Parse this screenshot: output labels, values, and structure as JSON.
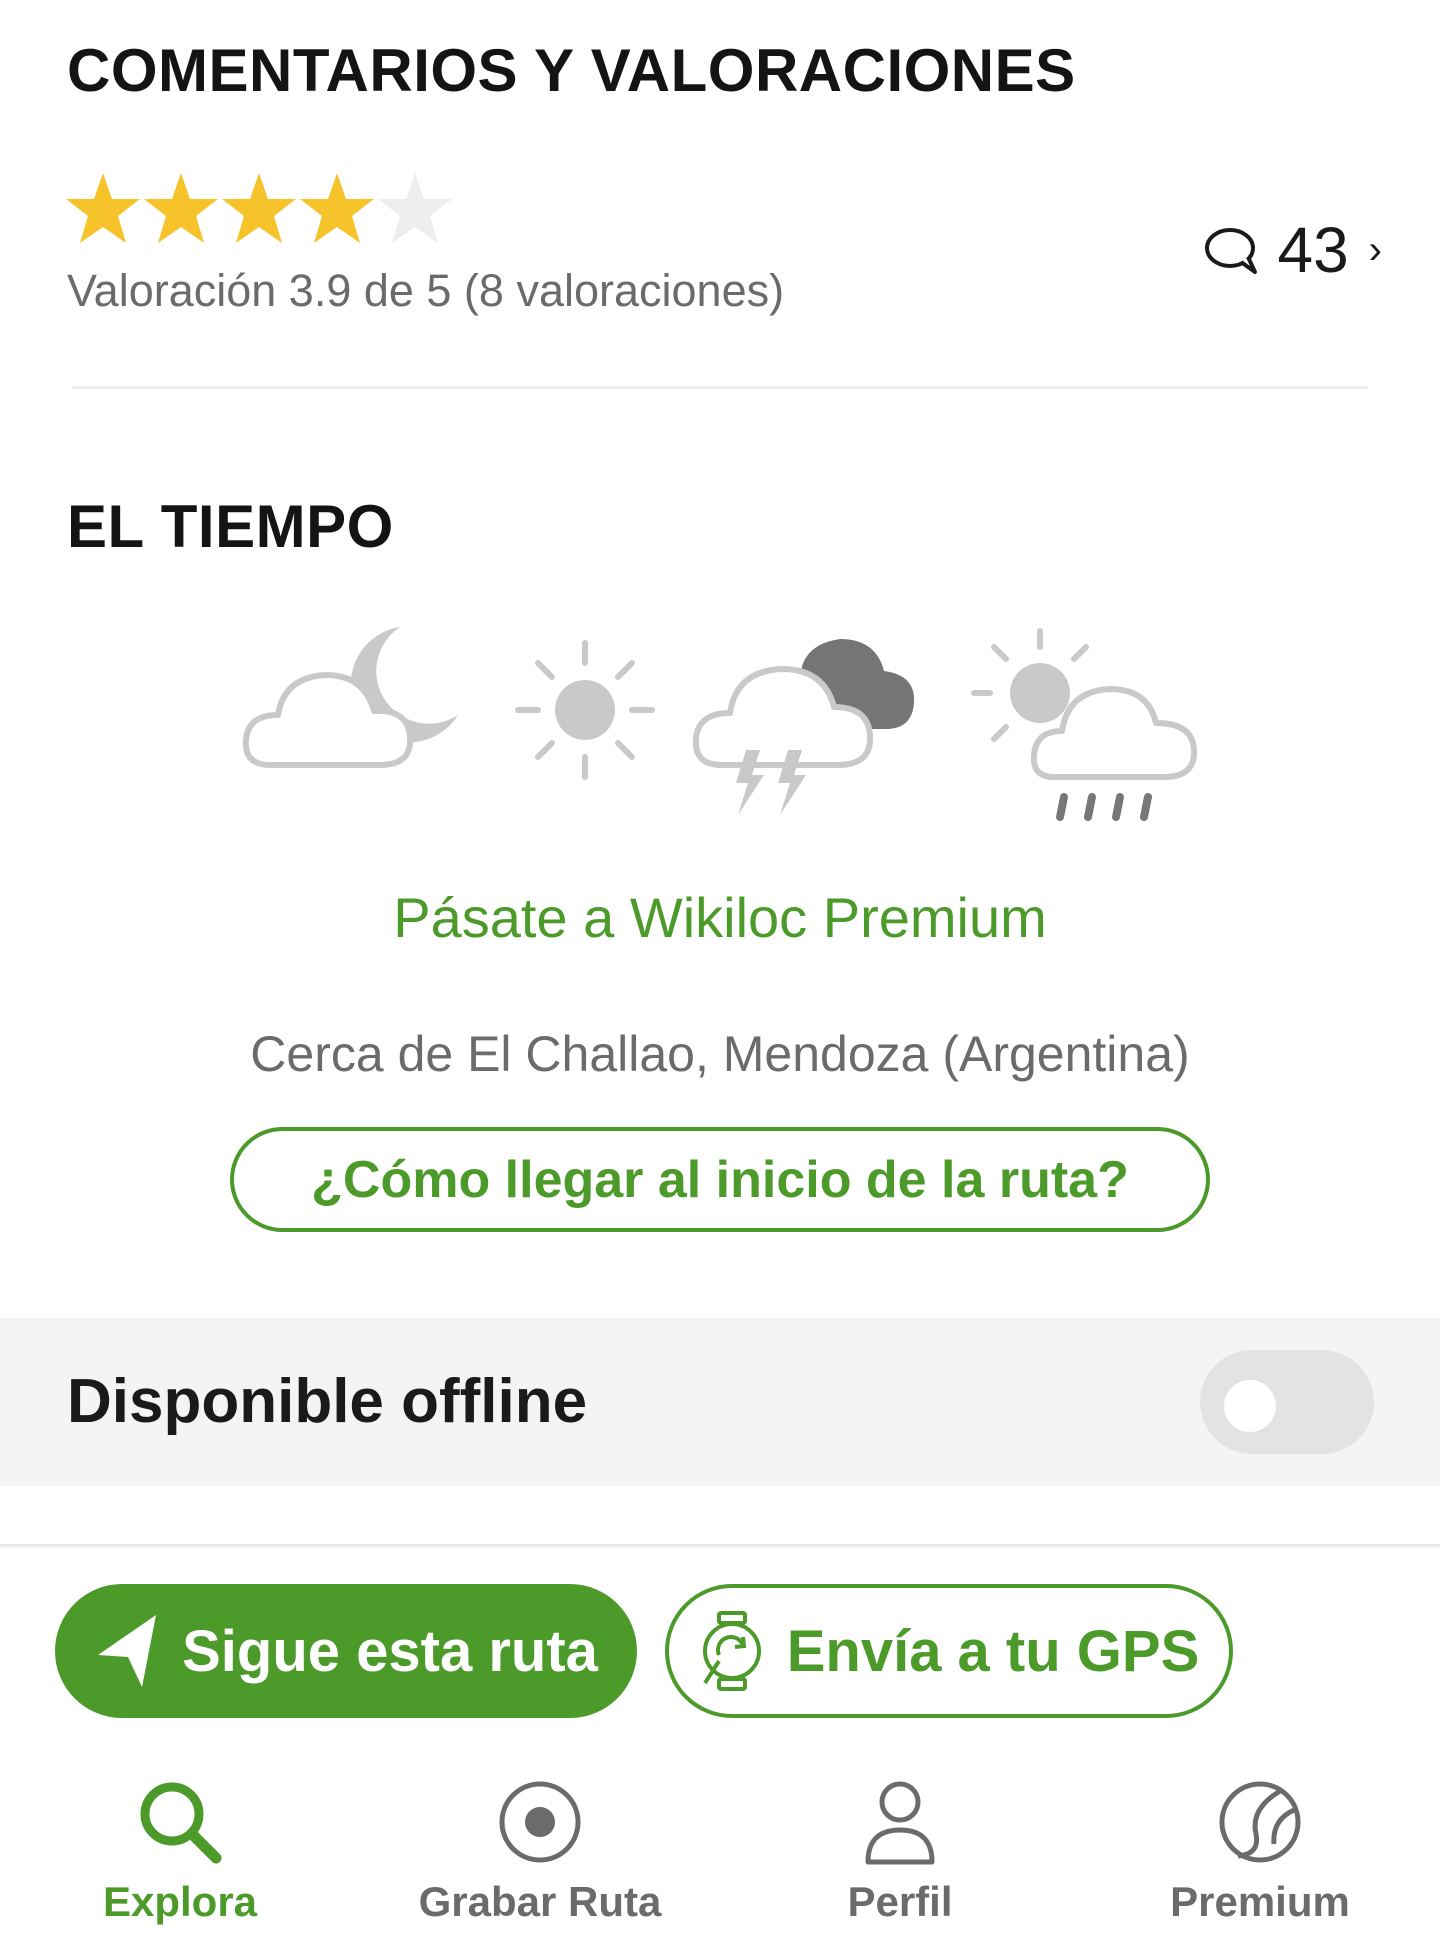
{
  "reviews": {
    "title": "COMENTARIOS Y VALORACIONES",
    "rating": 3.9,
    "rating_max": 5,
    "rating_text": "Valoración 3.9 de 5 (8 valoraciones)",
    "comments_count": "43",
    "comments_chevron": "›",
    "icons": {
      "comments": "speech-bubble-icon",
      "star": "star-icon"
    }
  },
  "weather": {
    "title": "EL TIEMPO",
    "icons": [
      "cloud-moon-icon",
      "sun-icon",
      "thunderstorm-icon",
      "sun-rain-icon"
    ],
    "premium_link": "Pásate a Wikiloc Premium",
    "location": "Cerca de El Challao, Mendoza (Argentina)",
    "directions_button": "¿Cómo llegar al inicio de la ruta?"
  },
  "offline": {
    "label": "Disponible offline",
    "enabled": false
  },
  "actions": {
    "follow": "Sigue esta ruta",
    "send_gps": "Envía a tu GPS"
  },
  "nav": {
    "items": [
      {
        "label": "Explora",
        "icon": "search-icon",
        "active": true
      },
      {
        "label": "Grabar Ruta",
        "icon": "record-icon",
        "active": false
      },
      {
        "label": "Perfil",
        "icon": "user-icon",
        "active": false
      },
      {
        "label": "Premium",
        "icon": "premium-ball-icon",
        "active": false
      }
    ]
  },
  "colors": {
    "brand_green": "#4c9a2a",
    "star_gold": "#f7c32b",
    "star_empty": "#eeeeee",
    "muted_text": "#6b6b6b",
    "weather_gray": "#c9c9c9"
  }
}
